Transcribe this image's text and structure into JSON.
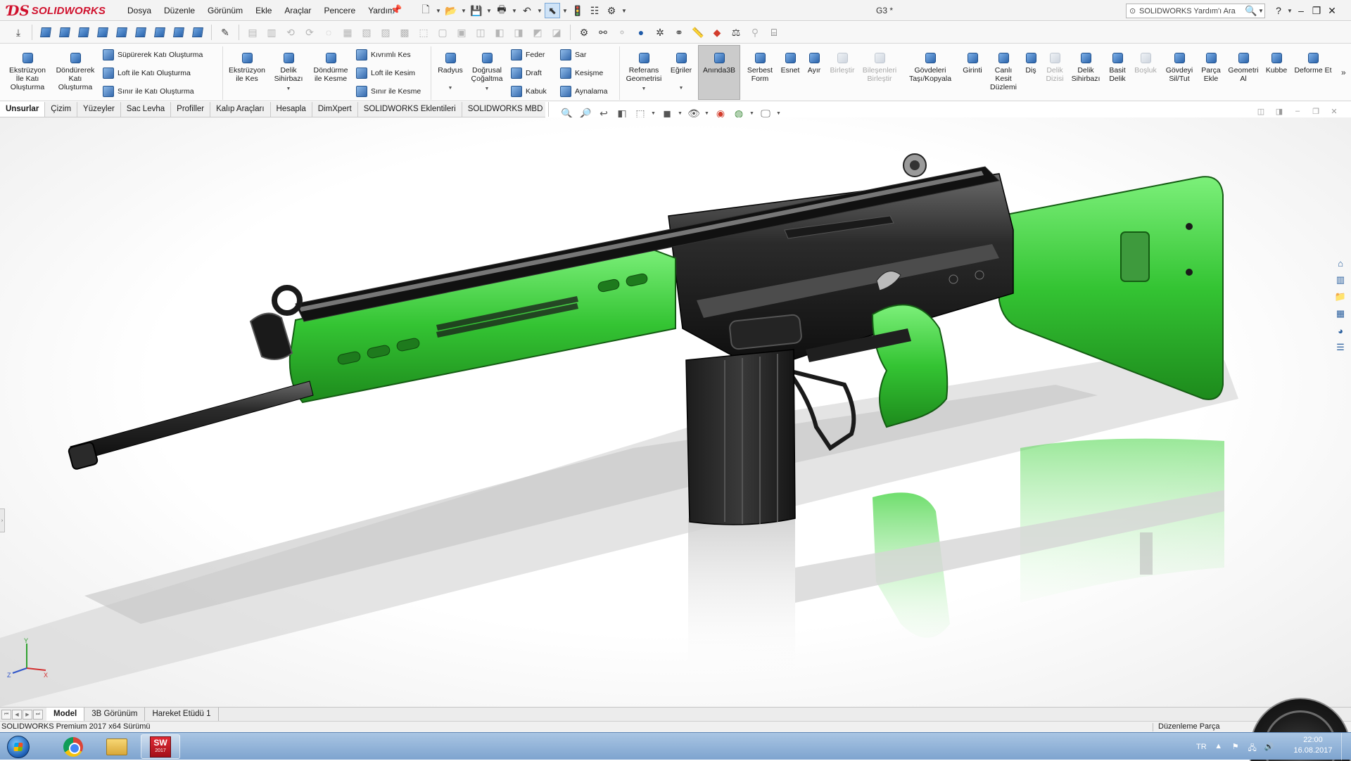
{
  "app": {
    "brand": "SOLIDWORKS",
    "document_title": "G3 *"
  },
  "menu": [
    "Dosya",
    "Düzenle",
    "Görünüm",
    "Ekle",
    "Araçlar",
    "Pencere",
    "Yardım"
  ],
  "help_search": {
    "placeholder": "SOLIDWORKS Yardım'ı Ara"
  },
  "ribbon": {
    "extrude_boss": "Ekstrüzyon İle Katı Oluşturma",
    "revolve_boss": "Döndürerek Katı Oluşturma",
    "sweep_boss": "Süpürerek Katı Oluşturma",
    "loft_boss": "Loft ile Katı Oluşturma",
    "boundary_boss": "Sınır ile Katı Oluşturma",
    "extrude_cut": "Ekstrüzyon ile Kes",
    "hole_wizard": "Delik Sihirbazı",
    "revolve_cut": "Döndürme ile Kesme",
    "swept_cut": "Kıvrımlı Kes",
    "loft_cut": "Loft ile Kesim",
    "boundary_cut": "Sınır ile Kesme",
    "fillet": "Radyus",
    "linear_pattern": "Doğrusal Çoğaltma",
    "rib": "Feder",
    "draft": "Draft",
    "shell": "Kabuk",
    "wrap": "Sar",
    "intersect": "Kesişme",
    "mirror": "Aynalama",
    "ref_geometry": "Referans Geometrisi",
    "curves": "Eğriler",
    "instant3d": "Anında3B",
    "freeform": "Serbest Form",
    "flex": "Esnet",
    "split": "Ayır",
    "combine": "Birleştir",
    "join": "Bileşenleri Birleştir",
    "move_copy": "Gövdeleri Taşı/Kopyala",
    "indent": "Girinti",
    "live_section": "Canlı Kesit Düzlemi",
    "thread": "Diş",
    "hole_series": "Delik Dizisi",
    "hole_wizard2": "Delik Sihirbazı",
    "simple_hole": "Basit Delik",
    "cavity": "Boşluk",
    "delete_body": "Gövdeyi Sil/Tut",
    "insert_part": "Parça Ekle",
    "geometry": "Geometri Al",
    "dome": "Kubbe",
    "deform": "Deforme Et"
  },
  "tabs": [
    "Unsurlar",
    "Çizim",
    "Yüzeyler",
    "Sac Levha",
    "Profiller",
    "Kalıp Araçları",
    "Hesapla",
    "DimXpert",
    "SOLIDWORKS Eklentileri",
    "SOLIDWORKS MBD"
  ],
  "bottom_tabs": [
    "Model",
    "3B Görünüm",
    "Hareket Etüdü 1"
  ],
  "status": {
    "left": "SOLIDWORKS Premium 2017 x64 Sürümü",
    "right": "Düzenleme Parça"
  },
  "triad": {
    "x": "X",
    "y": "Y",
    "z": "Z"
  },
  "taskbar": {
    "sw_label": "SW",
    "sw_year": "2017",
    "lang": "TR",
    "time": "22:00",
    "date": "16.08.2017"
  },
  "colors": {
    "accent_green": "#3cd23a",
    "brand_red": "#d0102c",
    "metal_dark": "#2a2a2a"
  }
}
